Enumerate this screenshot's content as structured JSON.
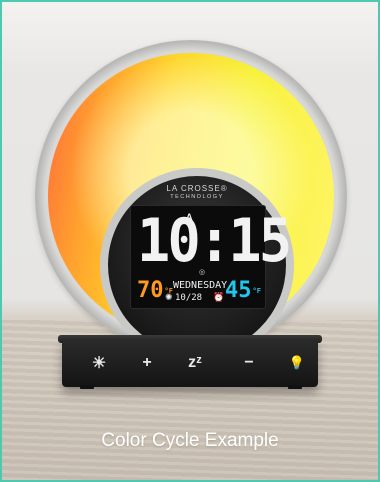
{
  "caption": "Color Cycle Example",
  "clock": {
    "brand_line1": "LA CROSSE®",
    "brand_line2": "TECHNOLOGY",
    "time": "10:15",
    "ampm": "A",
    "indoor_temp": "70",
    "indoor_unit": "°F",
    "day": "WEDNESDAY",
    "date": "10/28",
    "outdoor_temp": "45",
    "outdoor_unit": "°F"
  },
  "base_buttons": [
    {
      "name": "light-mode-button",
      "icon": "sun-icon",
      "symbol": "☀"
    },
    {
      "name": "plus-button",
      "icon": "plus-icon",
      "symbol": "+"
    },
    {
      "name": "snooze-button",
      "icon": "snooze-icon",
      "symbol": "zᶻ"
    },
    {
      "name": "minus-button",
      "icon": "minus-icon",
      "symbol": "−"
    },
    {
      "name": "lamp-button",
      "icon": "lightbulb-icon",
      "symbol": "💡"
    }
  ],
  "colors": {
    "frame_border": "#4ec9b0",
    "indoor_temp": "#ff9a1f",
    "outdoor_temp": "#22c7f0",
    "glow_warm": "#ff6a3a",
    "glow_yellow": "#f8f23a"
  }
}
